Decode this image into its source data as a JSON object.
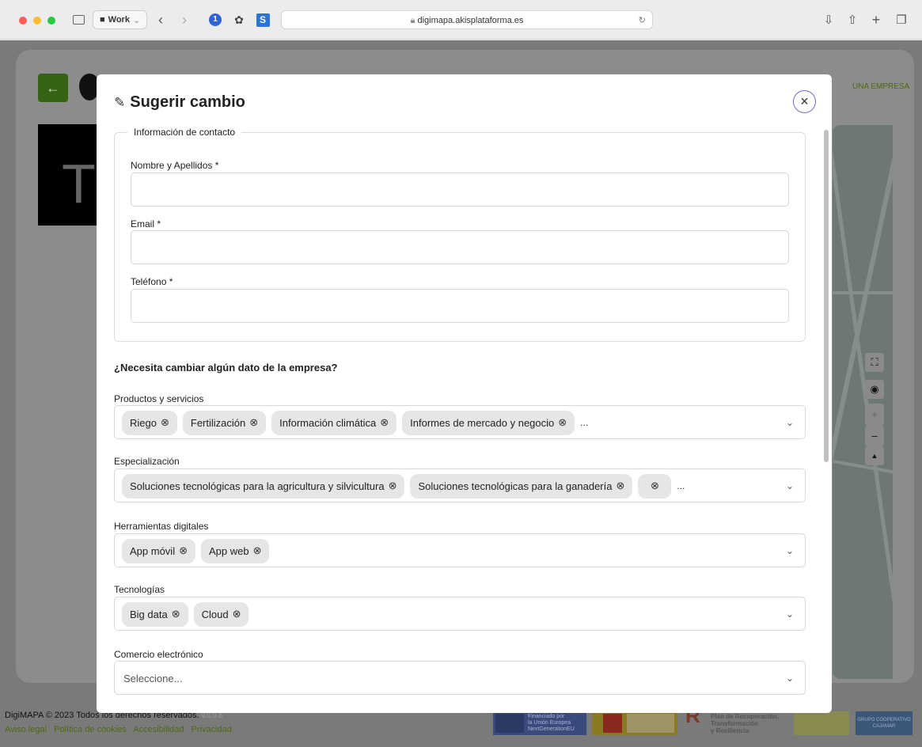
{
  "browser": {
    "profile_label": "Work",
    "url": "digimapa.akisplataforma.es"
  },
  "background": {
    "link_text": "UNA EMPRESA",
    "footer_copyright": "DigiMAPA © 2023 Todos los derechos reservados.",
    "footer_version": "v.0.9.8",
    "footer_links": [
      "Aviso legal",
      "Política de cookies",
      "Accesibilidad",
      "Privacidad"
    ],
    "eu_logo_lines": [
      "Financiado por",
      "la Unión Europea",
      "NextGenerationEU"
    ],
    "recovery_plan_lines": [
      "Plan de Recuperación,",
      "Transformación",
      "y Resiliencia"
    ],
    "grupo_logo_text": "GRUPO COOPERATIVO CAJAMAR"
  },
  "modal": {
    "title": "Sugerir cambio",
    "contact_legend": "Información de contacto",
    "name_label": "Nombre y Apellidos *",
    "email_label": "Email *",
    "phone_label": "Teléfono *",
    "section_question": "¿Necesita cambiar algún dato de la empresa?",
    "products": {
      "label": "Productos y servicios",
      "chips": [
        "Riego",
        "Fertilización",
        "Información climática",
        "Informes de mercado y negocio"
      ]
    },
    "specialization": {
      "label": "Especialización",
      "chips": [
        "Soluciones tecnológicas para la agricultura y silvicultura",
        "Soluciones tecnológicas para la ganadería"
      ]
    },
    "digital_tools": {
      "label": "Herramientas digitales",
      "chips": [
        "App móvil",
        "App web"
      ]
    },
    "technologies": {
      "label": "Tecnologías",
      "chips": [
        "Big data",
        "Cloud"
      ]
    },
    "ecommerce": {
      "label": "Comercio electrónico",
      "placeholder": "Seleccione..."
    },
    "more_indicator": "..."
  }
}
